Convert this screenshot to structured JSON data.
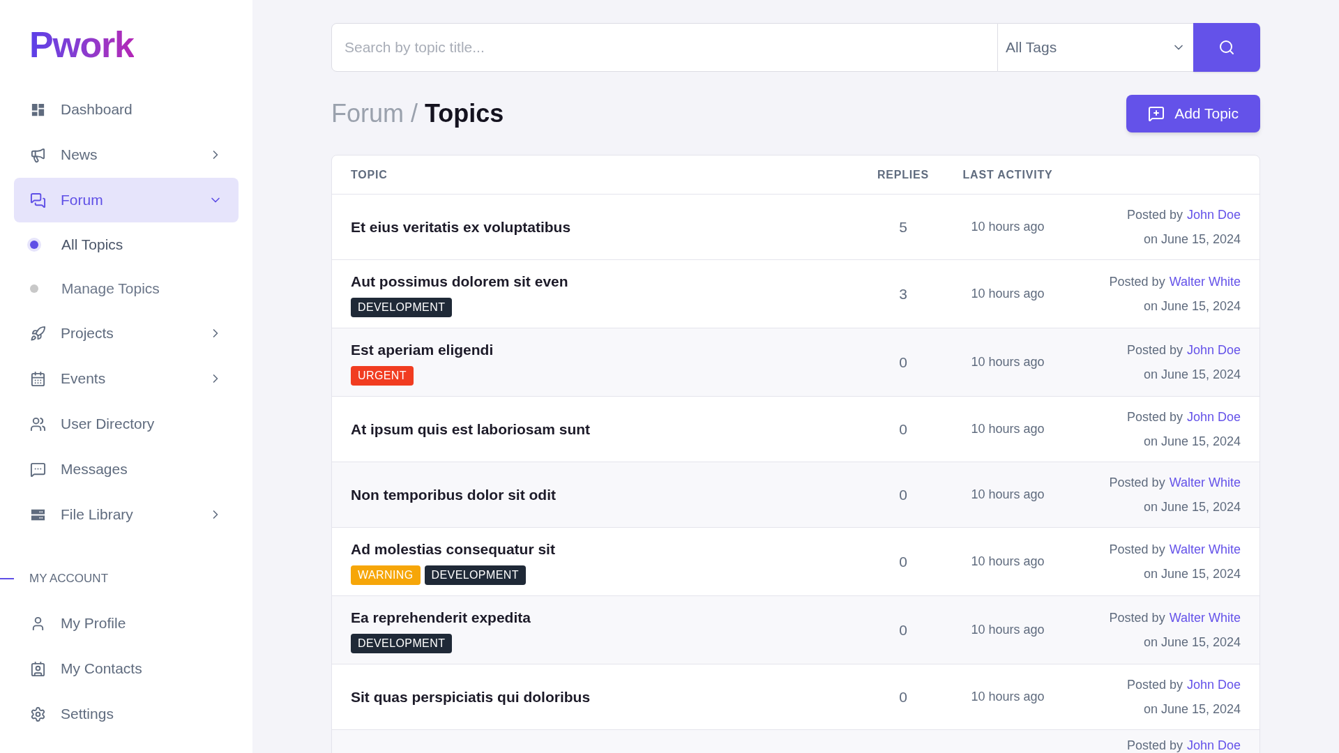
{
  "sidebar": {
    "logo": "Pwork",
    "nav": [
      {
        "label": "Dashboard",
        "selected": false
      },
      {
        "label": "News",
        "selected": false,
        "expanded": false
      },
      {
        "label": "Forum",
        "selected": true,
        "expanded": true,
        "children": [
          {
            "label": "All Topics",
            "selected": true
          },
          {
            "label": "Manage Topics",
            "selected": false
          }
        ]
      },
      {
        "label": "Projects",
        "selected": false,
        "expanded": false
      },
      {
        "label": "Events",
        "selected": false,
        "expanded": false
      },
      {
        "label": "User Directory",
        "selected": false
      },
      {
        "label": "Messages",
        "selected": false
      },
      {
        "label": "File Library",
        "selected": false,
        "expanded": false
      }
    ],
    "section_title": "MY ACCOUNT",
    "account": [
      {
        "label": "My Profile",
        "selected": false
      },
      {
        "label": "My Contacts",
        "selected": false
      },
      {
        "label": "Settings",
        "selected": false
      }
    ]
  },
  "search": {
    "placeholder": "Search by topic title...",
    "tag_filter": "All Tags"
  },
  "breadcrumb": {
    "parent": "Forum",
    "separator": "/",
    "current": "Topics"
  },
  "add_button": "Add Topic",
  "table": {
    "columns": [
      "TOPIC",
      "REPLIES",
      "LAST ACTIVITY"
    ],
    "rows": [
      {
        "title": "Et eius veritatis ex voluptatibus",
        "tags": [],
        "replies": "5",
        "activity": "10 hours ago",
        "posted_by": "Posted by",
        "author": "John Doe",
        "date": "on June 15, 2024"
      },
      {
        "title": "Aut possimus dolorem sit even",
        "tags": [
          {
            "label": "DEVELOPMENT",
            "color": "#1f2937"
          }
        ],
        "replies": "3",
        "activity": "10 hours ago",
        "posted_by": "Posted by",
        "author": "Walter White",
        "date": "on June 15, 2024"
      },
      {
        "title": "Est aperiam eligendi",
        "tags": [
          {
            "label": "URGENT",
            "color": "#f13c20"
          }
        ],
        "replies": "0",
        "activity": "10 hours ago",
        "posted_by": "Posted by",
        "author": "John Doe",
        "date": "on June 15, 2024"
      },
      {
        "title": "At ipsum quis est laboriosam sunt",
        "tags": [],
        "replies": "0",
        "activity": "10 hours ago",
        "posted_by": "Posted by",
        "author": "John Doe",
        "date": "on June 15, 2024"
      },
      {
        "title": "Non temporibus dolor sit odit",
        "tags": [],
        "replies": "0",
        "activity": "10 hours ago",
        "posted_by": "Posted by",
        "author": "Walter White",
        "date": "on June 15, 2024"
      },
      {
        "title": "Ad molestias consequatur sit",
        "tags": [
          {
            "label": "WARNING",
            "color": "#f6a609"
          },
          {
            "label": "DEVELOPMENT",
            "color": "#1f2937"
          }
        ],
        "replies": "0",
        "activity": "10 hours ago",
        "posted_by": "Posted by",
        "author": "Walter White",
        "date": "on June 15, 2024"
      },
      {
        "title": "Ea reprehenderit expedita",
        "tags": [
          {
            "label": "DEVELOPMENT",
            "color": "#1f2937"
          }
        ],
        "replies": "0",
        "activity": "10 hours ago",
        "posted_by": "Posted by",
        "author": "Walter White",
        "date": "on June 15, 2024"
      },
      {
        "title": "Sit quas perspiciatis qui doloribus",
        "tags": [],
        "replies": "0",
        "activity": "10 hours ago",
        "posted_by": "Posted by",
        "author": "John Doe",
        "date": "on June 15, 2024"
      },
      {
        "posted_by": "Posted by",
        "author": "John Doe"
      }
    ]
  }
}
